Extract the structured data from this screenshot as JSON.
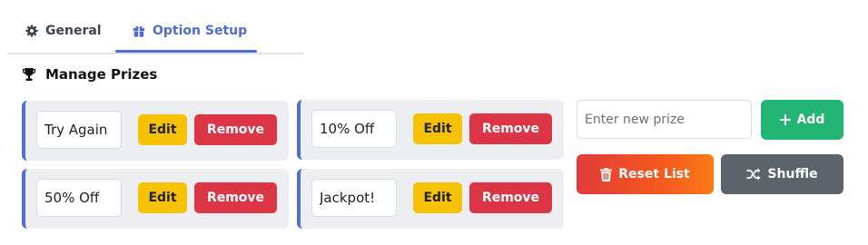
{
  "tabs": [
    {
      "label": "General",
      "icon": "gear-icon",
      "active": false
    },
    {
      "label": "Option Setup",
      "icon": "gift-icon",
      "active": true
    }
  ],
  "section": {
    "title": "Manage Prizes",
    "icon": "trophy-icon"
  },
  "prizes": [
    {
      "value": "Try Again",
      "edit_label": "Edit",
      "remove_label": "Remove"
    },
    {
      "value": "10% Off",
      "edit_label": "Edit",
      "remove_label": "Remove"
    },
    {
      "value": "50% Off",
      "edit_label": "Edit",
      "remove_label": "Remove"
    },
    {
      "value": "Jackpot!",
      "edit_label": "Edit",
      "remove_label": "Remove"
    }
  ],
  "controls": {
    "new_prize_placeholder": "Enter new prize",
    "add_label": "Add",
    "reset_label": "Reset List",
    "shuffle_label": "Shuffle"
  },
  "colors": {
    "accent": "#4f6bd6",
    "edit": "#f7c106",
    "remove": "#dc3545",
    "add": "#22b573",
    "shuffle": "#5d636a"
  }
}
